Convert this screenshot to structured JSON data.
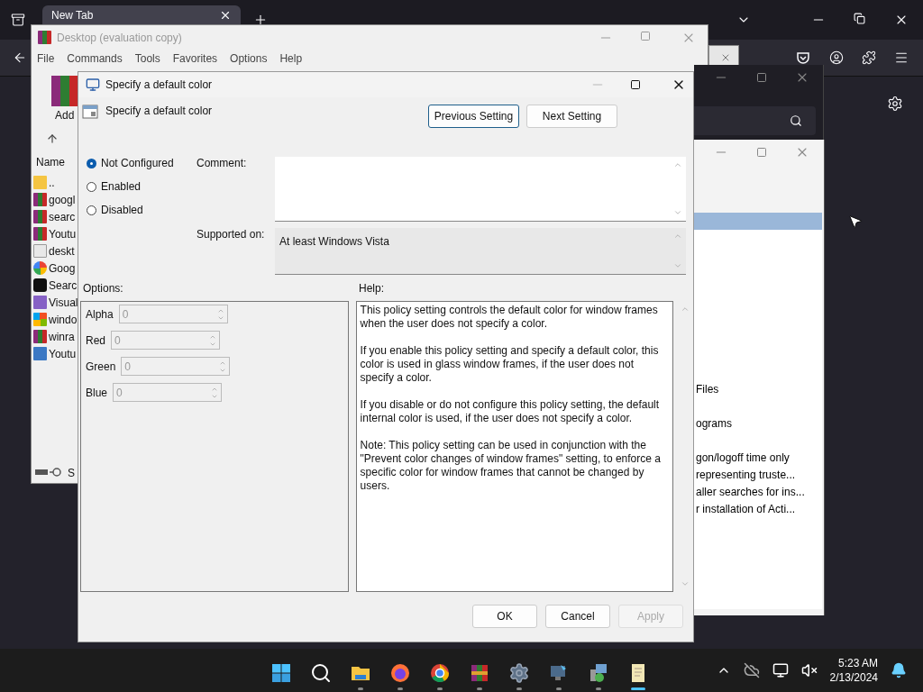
{
  "browser": {
    "tabs": [
      {
        "label": "New Tab",
        "selected": true
      }
    ]
  },
  "archiver_window": {
    "title": "Desktop (evaluation copy)",
    "menu": [
      "File",
      "Commands",
      "Tools",
      "Favorites",
      "Options",
      "Help"
    ],
    "toolbar": [
      "Add"
    ],
    "column": "Name",
    "files": [
      {
        "name": "..",
        "kind": "folder"
      },
      {
        "name": "googl",
        "kind": "archive"
      },
      {
        "name": "searc",
        "kind": "archive"
      },
      {
        "name": "Youtu",
        "kind": "archive"
      },
      {
        "name": "deskt",
        "kind": "doc"
      },
      {
        "name": "Goog",
        "kind": "g"
      },
      {
        "name": "Searc",
        "kind": "s"
      },
      {
        "name": "Visual",
        "kind": "studio"
      },
      {
        "name": "windo",
        "kind": "flag"
      },
      {
        "name": "winra",
        "kind": "archive"
      },
      {
        "name": "Youtu",
        "kind": "video"
      }
    ],
    "status": "S"
  },
  "policy_window": {
    "rows": [
      {
        "selected": true
      },
      {
        "text": "Files",
        "selected": false
      },
      {
        "text": "ograms",
        "selected": false
      },
      {
        "text": "gon/logoff time only",
        "selected": false
      },
      {
        "text": "representing truste...",
        "selected": false
      },
      {
        "text": "aller searches for ins...",
        "selected": false
      },
      {
        "text": "r installation of Acti...",
        "selected": false
      }
    ]
  },
  "dialog": {
    "title": "Specify a default color",
    "heading": "Specify a default color",
    "nav_buttons": [
      {
        "label": "Previous Setting",
        "focused": true
      },
      {
        "label": "Next Setting",
        "focused": false
      }
    ],
    "states": [
      {
        "label": "Not Configured",
        "selected": true
      },
      {
        "label": "Enabled",
        "selected": false
      },
      {
        "label": "Disabled",
        "selected": false
      }
    ],
    "comment_label": "Comment:",
    "supported_label": "Supported on:",
    "supported_value": "At least Windows Vista",
    "options_label": "Options:",
    "help_label": "Help:",
    "options": [
      {
        "label": "Alpha",
        "value": "0",
        "disabled": true
      },
      {
        "label": "Red",
        "value": "0",
        "disabled": true
      },
      {
        "label": "Green",
        "value": "0",
        "disabled": true
      },
      {
        "label": "Blue",
        "value": "0",
        "disabled": true
      }
    ],
    "help": [
      "This policy setting controls the default color for window frames when the user does not specify a color.",
      "If you enable this policy setting and specify a default color, this color is used in glass window frames, if the user does not specify a color.",
      "If you disable or do not configure this policy setting, the default internal color is used, if the user does not specify a color.",
      "Note: This policy setting can be used in conjunction with the \"Prevent color changes of window frames\" setting, to enforce a specific color for window frames that cannot be changed by users."
    ],
    "buttons": [
      {
        "label": "OK",
        "disabled": false
      },
      {
        "label": "Cancel",
        "disabled": false
      },
      {
        "label": "Apply",
        "disabled": true
      }
    ]
  },
  "taskbar": {
    "apps": [
      {
        "kind": "start",
        "running": false,
        "active": false
      },
      {
        "kind": "search",
        "running": false,
        "active": false
      },
      {
        "kind": "folder",
        "running": true,
        "active": false
      },
      {
        "kind": "fox",
        "running": true,
        "active": false
      },
      {
        "kind": "ring",
        "running": true,
        "active": false
      },
      {
        "kind": "books",
        "running": true,
        "active": false
      },
      {
        "kind": "gear",
        "running": true,
        "active": false
      },
      {
        "kind": "remote",
        "running": true,
        "active": false
      },
      {
        "kind": "installer",
        "running": true,
        "active": false
      },
      {
        "kind": "scroll",
        "running": false,
        "active": true
      }
    ],
    "time": "5:23 AM",
    "date": "2/13/2024"
  }
}
